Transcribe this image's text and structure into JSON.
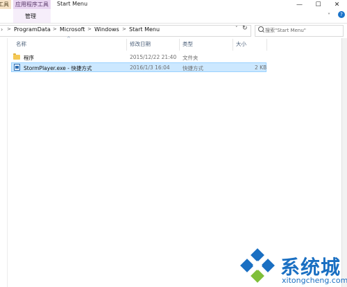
{
  "ribbon": {
    "ctx_tab_left_label": "工具",
    "ctx_tab_label": "应用程序工具",
    "manage_label": "管理",
    "window_title": "Start Menu",
    "minimize": "—",
    "maximize": "☐",
    "close": "✕",
    "help": "?"
  },
  "address": {
    "crumbs": [
      "ProgramData",
      "Microsoft",
      "Windows",
      "Start Menu"
    ],
    "left_glyph": "›",
    "separator": ">",
    "search_placeholder": "搜索\"Start Menu\""
  },
  "columns": {
    "name": "名称",
    "modified": "修改日期",
    "type": "类型",
    "size": "大小"
  },
  "files": [
    {
      "name": "程序",
      "modified": "2015/12/22 21:40",
      "type": "文件夹",
      "size": "",
      "icon": "folder-icon",
      "selected": false
    },
    {
      "name": "StormPlayer.exe - 快捷方式",
      "modified": "2016/1/3 16:04",
      "type": "快捷方式",
      "size": "2 KB",
      "icon": "shortcut-icon",
      "selected": true
    }
  ],
  "watermark": {
    "brand": "系统城",
    "url": "xitongcheng.com",
    "colors": {
      "primary": "#1a6fc2",
      "secondary": "#7fbf3a"
    }
  }
}
